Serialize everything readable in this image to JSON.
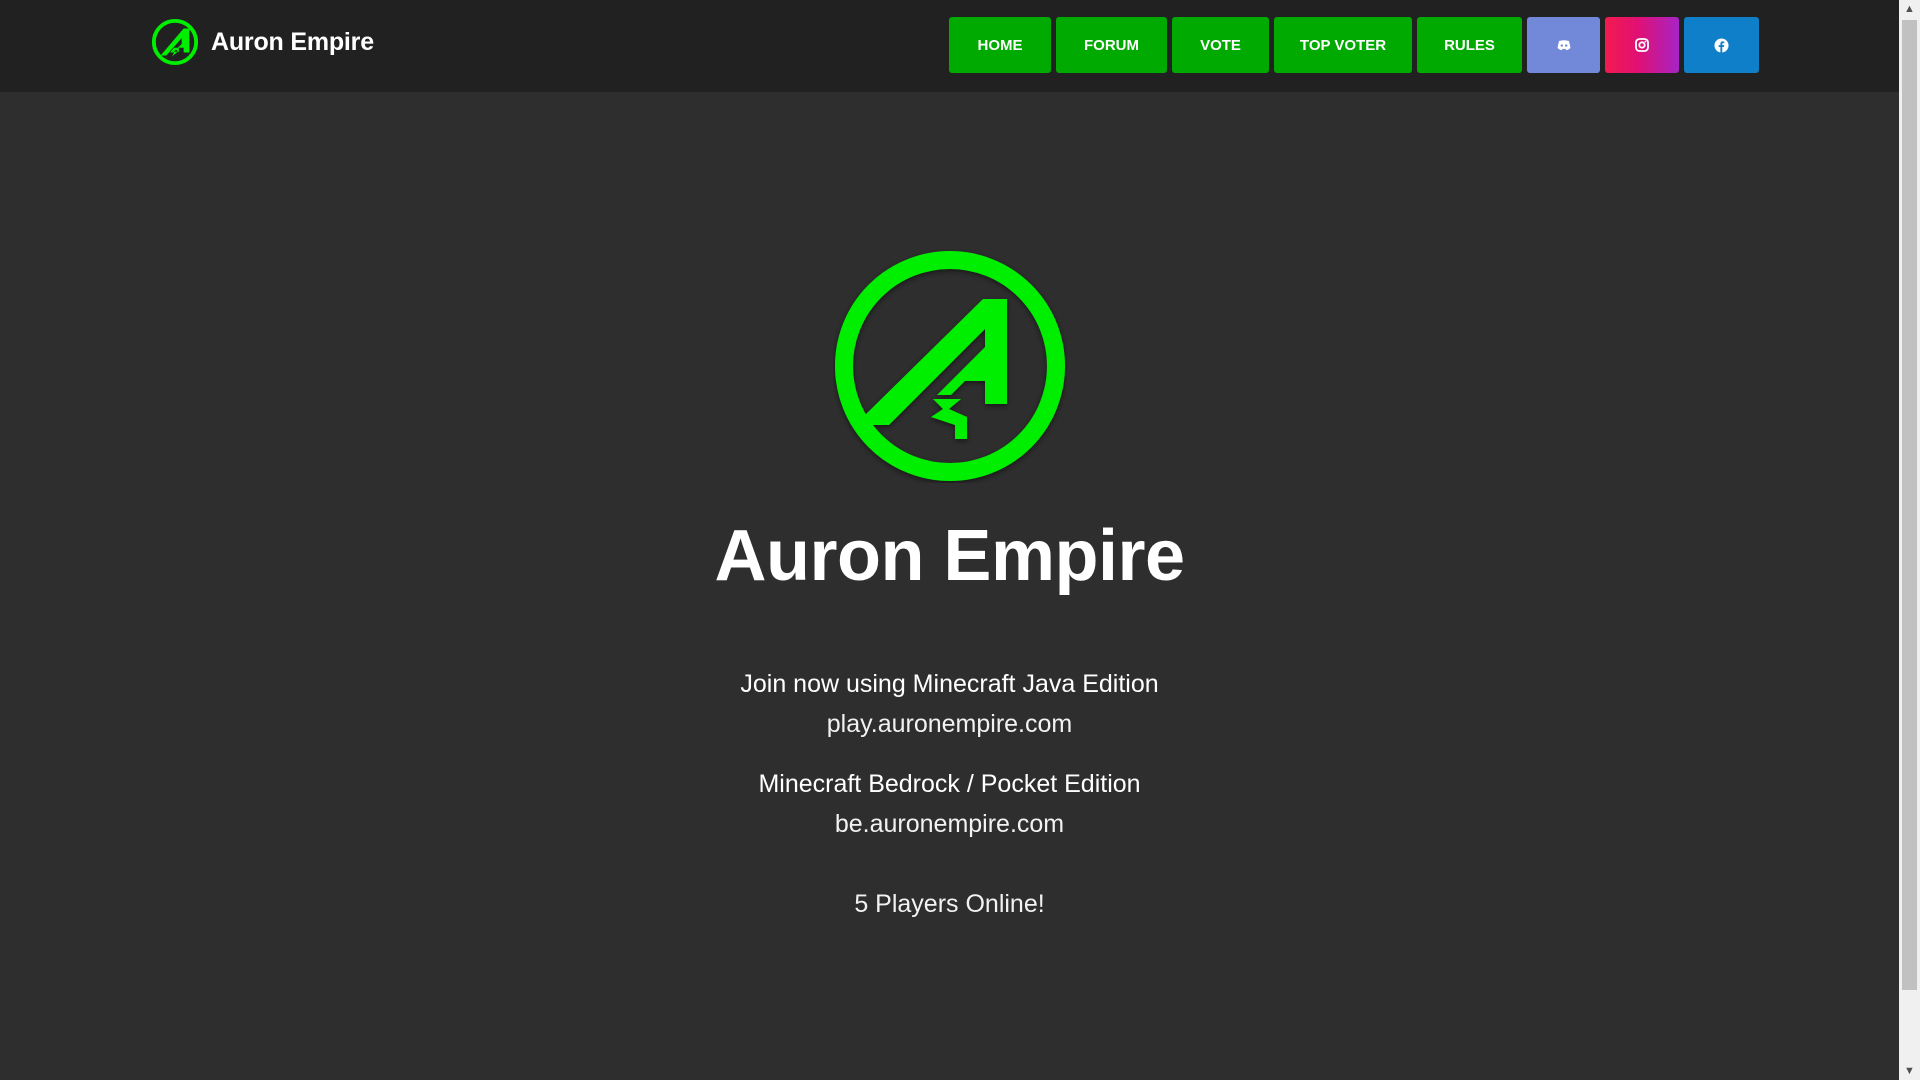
{
  "brand": {
    "name": "Auron Empire"
  },
  "nav": {
    "items": [
      {
        "label": "HOME"
      },
      {
        "label": "FORUM"
      },
      {
        "label": "VOTE"
      },
      {
        "label": "TOP VOTER"
      },
      {
        "label": "RULES"
      }
    ],
    "social": [
      {
        "icon": "discord-icon",
        "color": "#7289da"
      },
      {
        "icon": "instagram-icon",
        "color": "#e01074"
      },
      {
        "icon": "facebook-icon",
        "color": "#0e7fc8"
      }
    ]
  },
  "hero": {
    "title": "Auron Empire",
    "java_label": "Join now using Minecraft Java Edition",
    "java_address": "play.auronempire.com",
    "bedrock_label": "Minecraft Bedrock / Pocket Edition",
    "bedrock_address": "be.auronempire.com",
    "players_online": "5 Players Online!"
  },
  "colors": {
    "accent": "#00aa00",
    "logo_green": "#00ee00",
    "background": "#2e2e2e",
    "navbar": "#212121"
  }
}
